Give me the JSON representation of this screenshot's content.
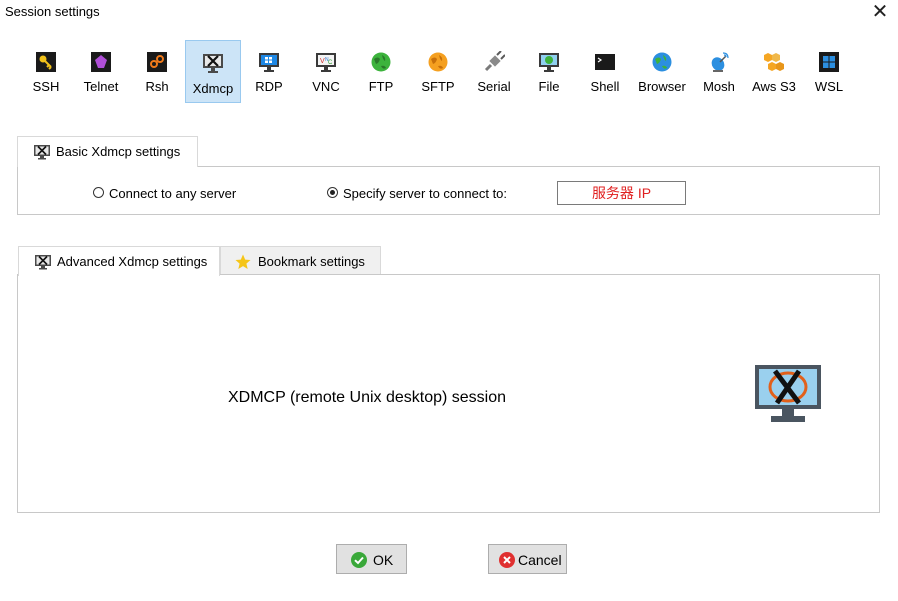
{
  "window": {
    "title": "Session settings",
    "close_glyph": "✕"
  },
  "toolbar": {
    "items": [
      {
        "label": "SSH",
        "icon": "key-icon"
      },
      {
        "label": "Telnet",
        "icon": "telnet-icon"
      },
      {
        "label": "Rsh",
        "icon": "rsh-icon"
      },
      {
        "label": "Xdmcp",
        "icon": "xdmcp-icon",
        "selected": true
      },
      {
        "label": "RDP",
        "icon": "rdp-icon"
      },
      {
        "label": "VNC",
        "icon": "vnc-icon"
      },
      {
        "label": "FTP",
        "icon": "ftp-globe-icon"
      },
      {
        "label": "SFTP",
        "icon": "sftp-globe-icon"
      },
      {
        "label": "Serial",
        "icon": "serial-plug-icon"
      },
      {
        "label": "File",
        "icon": "file-globe-icon"
      },
      {
        "label": "Shell",
        "icon": "shell-terminal-icon"
      },
      {
        "label": "Browser",
        "icon": "browser-globe-icon"
      },
      {
        "label": "Mosh",
        "icon": "mosh-satellite-icon"
      },
      {
        "label": "Aws S3",
        "icon": "aws-s3-icon"
      },
      {
        "label": "WSL",
        "icon": "wsl-windows-icon"
      }
    ]
  },
  "basic": {
    "tab_label": "Basic Xdmcp settings",
    "option_any": "Connect to any server",
    "option_specify": "Specify server to connect to:",
    "selected_option": "specify",
    "server_value": "服务器 IP"
  },
  "advanced": {
    "tab_advanced": "Advanced Xdmcp settings",
    "tab_bookmark": "Bookmark settings",
    "description": "XDMCP (remote Unix desktop) session"
  },
  "buttons": {
    "ok": "OK",
    "cancel": "Cancel"
  },
  "colors": {
    "selected_bg": "#cce4f7",
    "selected_border": "#99c9ef",
    "server_text": "#e02020",
    "ok_green": "#3aa83a",
    "cancel_red": "#e03030"
  }
}
